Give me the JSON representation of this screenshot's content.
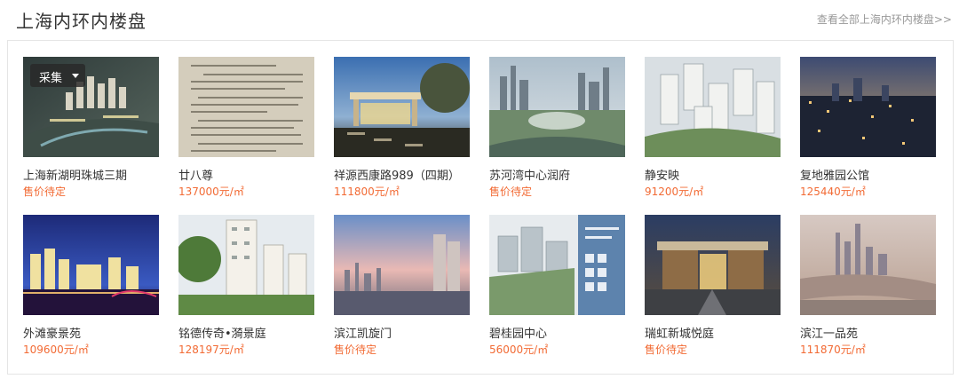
{
  "header": {
    "title": "上海内环内楼盘",
    "more_link": "查看全部上海内环内楼盘>>"
  },
  "collect_button": {
    "label": "采集"
  },
  "colors": {
    "price": "#f26b35",
    "title": "#333333",
    "link": "#999999"
  },
  "listings": [
    {
      "name": "上海新湖明珠城三期",
      "price": "售价待定"
    },
    {
      "name": "廿八尊",
      "price": "137000元/㎡"
    },
    {
      "name": "祥源西康路989（四期）",
      "price": "111800元/㎡"
    },
    {
      "name": "苏河湾中心润府",
      "price": "售价待定"
    },
    {
      "name": "静安映",
      "price": "91200元/㎡"
    },
    {
      "name": "复地雅园公馆",
      "price": "125440元/㎡"
    },
    {
      "name": "外滩豪景苑",
      "price": "109600元/㎡"
    },
    {
      "name": "铭德传奇•漪景庭",
      "price": "128197元/㎡"
    },
    {
      "name": "滨江凯旋门",
      "price": "售价待定"
    },
    {
      "name": "碧桂园中心",
      "price": "56000元/㎡"
    },
    {
      "name": "瑞虹新城悦庭",
      "price": "售价待定"
    },
    {
      "name": "滨江一品苑",
      "price": "111870元/㎡"
    }
  ]
}
